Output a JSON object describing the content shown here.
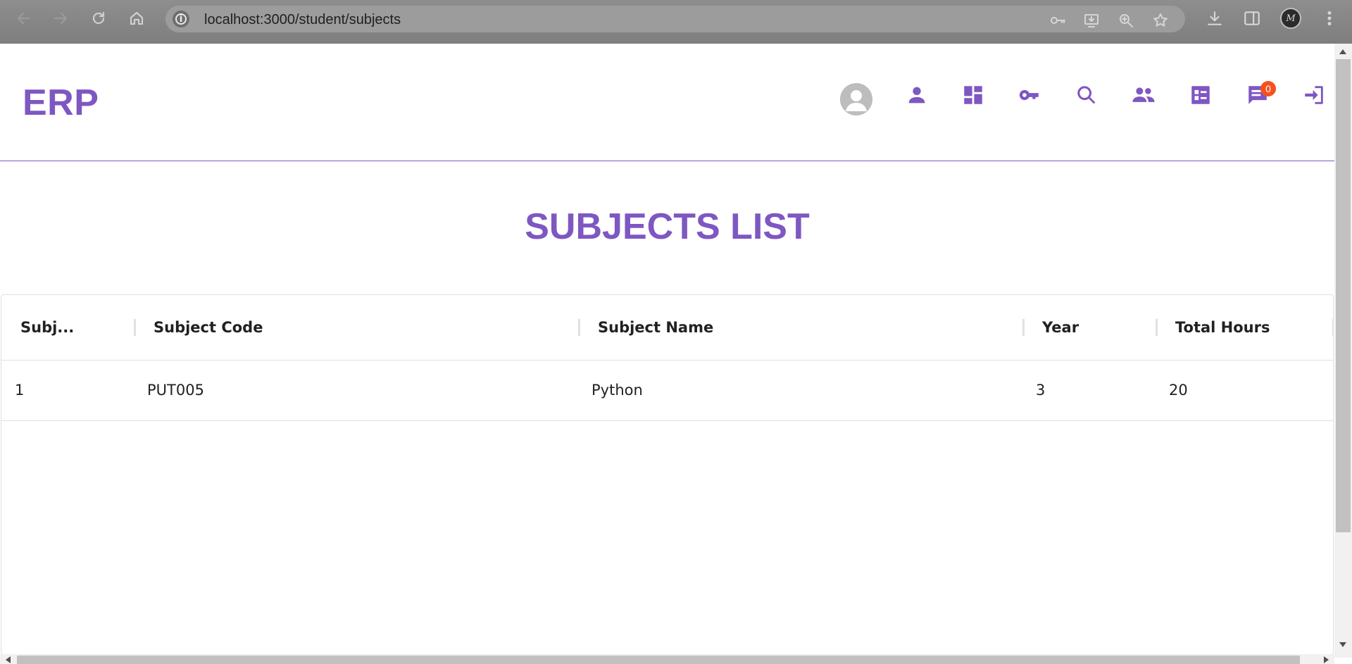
{
  "browser": {
    "url": "localhost:3000/student/subjects",
    "profile_initials": "M"
  },
  "app": {
    "logo": "ERP",
    "notification_count": "0",
    "accent_color": "#7e57c2",
    "badge_color": "#f4511e"
  },
  "page": {
    "title": "SUBJECTS LIST"
  },
  "table": {
    "columns": [
      "Subj...",
      "Subject Code",
      "Subject Name",
      "Year",
      "Total Hours"
    ],
    "rows": [
      [
        "1",
        "PUT005",
        "Python",
        "3",
        "20"
      ]
    ]
  }
}
